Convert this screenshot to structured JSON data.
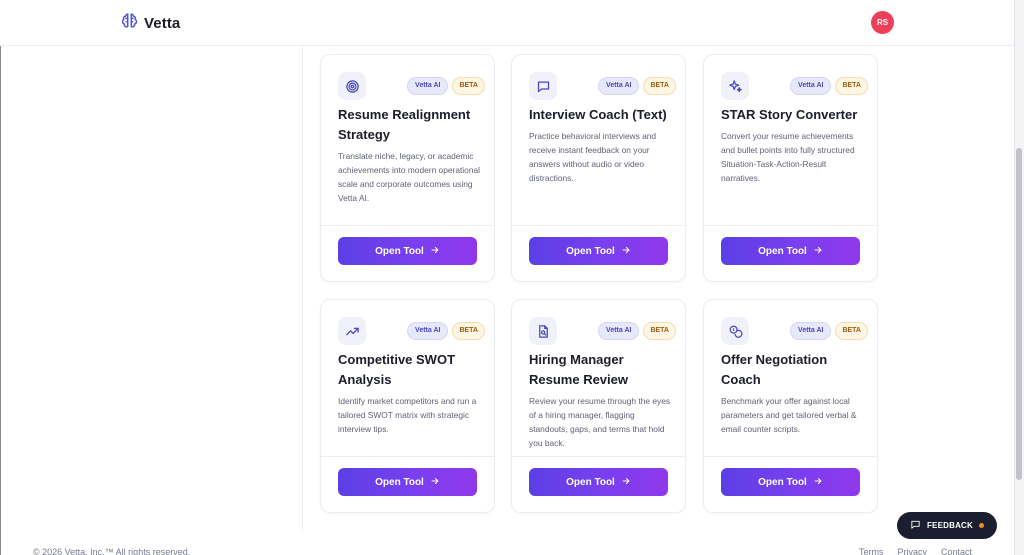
{
  "brand": {
    "name": "Vetta",
    "icon": "brain-icon",
    "color": "#4a4fe0"
  },
  "user": {
    "initials": "RS",
    "avatar_color": "#ee3f5a"
  },
  "badges": {
    "ai": "Vetta AI",
    "beta": "BETA"
  },
  "open_label": "Open Tool",
  "accent": {
    "button_start": "#5b3fe4",
    "button_end": "#8f38ea",
    "icon_color": "#4a47c4"
  },
  "tools": [
    {
      "id": "resume-realignment",
      "title": "Resume Realignment Strategy",
      "icon": "target-icon",
      "description": "Translate niche, legacy, or academic achievements into modern operational scale and corporate outcomes using Vetta AI."
    },
    {
      "id": "interview-coach",
      "title": "Interview Coach (Text)",
      "icon": "chat-bubble-icon",
      "description": "Practice behavioral interviews and receive instant feedback on your answers without audio or video distractions."
    },
    {
      "id": "star-story",
      "title": "STAR Story Converter",
      "icon": "sparkles-icon",
      "description": "Convert your resume achievements and bullet points into fully structured Situation-Task-Action-Result narratives."
    },
    {
      "id": "swot",
      "title": "Competitive SWOT Analysis",
      "icon": "trending-up-icon",
      "description": "Identify market competitors and run a tailored SWOT matrix with strategic interview tips."
    },
    {
      "id": "hiring-manager",
      "title": "Hiring Manager Resume Review",
      "icon": "document-search-icon",
      "description": "Review your resume through the eyes of a hiring manager, flagging standouts, gaps, and terms that hold you back."
    },
    {
      "id": "offer-negotiation",
      "title": "Offer Negotiation Coach",
      "icon": "coins-icon",
      "description": "Benchmark your offer against local parameters and get tailored verbal & email counter scripts."
    }
  ],
  "feedback": {
    "label": "FEEDBACK",
    "icon": "message-square-icon",
    "dot_color": "#f08a2a"
  },
  "footer": {
    "copyright": "© 2026 Vetta, Inc.™ All rights reserved.",
    "links": [
      "Terms",
      "Privacy",
      "Contact"
    ]
  }
}
